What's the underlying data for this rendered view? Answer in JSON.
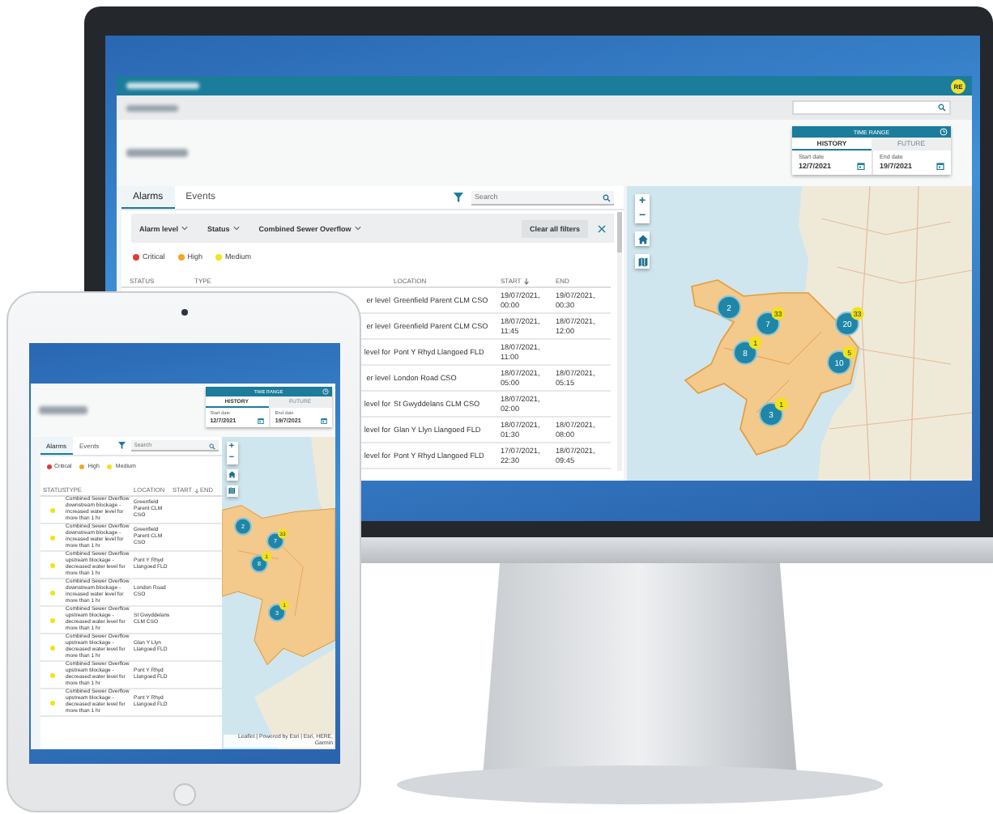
{
  "monitor": {
    "app": {
      "header": {
        "avatar": "RE"
      },
      "time_range": {
        "title": "TIME RANGE",
        "tabs": [
          {
            "label": "HISTORY",
            "selected": true
          },
          {
            "label": "FUTURE",
            "selected": false
          }
        ],
        "fields": [
          {
            "label": "Start date",
            "value": "12/7/2021"
          },
          {
            "label": "End date",
            "value": "19/7/2021"
          }
        ]
      },
      "alarms": {
        "tabs": [
          {
            "label": "Alarms",
            "selected": true
          },
          {
            "label": "Events",
            "selected": false
          }
        ],
        "search": {
          "placeholder": "Search"
        },
        "filters": [
          "Alarm level",
          "Status",
          "Combined Sewer Overflow"
        ],
        "clear_button": "Clear all filters",
        "legend": [
          {
            "label": "Critical",
            "color": "#e53935"
          },
          {
            "label": "High",
            "color": "#f5a623"
          },
          {
            "label": "Medium",
            "color": "#f2e21b"
          }
        ],
        "table": {
          "columns": [
            {
              "label": "STATUS",
              "sorted": false
            },
            {
              "label": "TYPE",
              "sorted": false
            },
            {
              "label": "LOCATION",
              "sorted": false
            },
            {
              "label": "START",
              "sorted": true
            },
            {
              "label": "END",
              "sorted": false
            }
          ],
          "rows": [
            {
              "type": "er level",
              "location": "Greenfield Parent CLM CSO",
              "start": "19/07/2021, 00:00",
              "end": "19/07/2021, 00:30"
            },
            {
              "type": "er level",
              "location": "Greenfield Parent CLM CSO",
              "start": "18/07/2021, 11:45",
              "end": "18/07/2021, 12:00"
            },
            {
              "type": "level for",
              "location": "Pont Y Rhyd Llangoed FLD",
              "start": "18/07/2021, 11:00"
            },
            {
              "type": "er level",
              "location": "London Road CSO",
              "start": "18/07/2021, 05:00",
              "end": "18/07/2021, 05:15"
            },
            {
              "type": "level for",
              "location": "St Gwyddelans CLM CSO",
              "start": "18/07/2021, 02:00"
            },
            {
              "type": "level for",
              "location": "Glan Y Llyn Llangoed FLD",
              "start": "18/07/2021, 01:30",
              "end": "18/07/2021, 08:00"
            },
            {
              "type": "level for",
              "location": "Pont Y Rhyd Llangoed FLD",
              "start": "17/07/2021, 22:30",
              "end": "18/07/2021, 09:45"
            }
          ]
        }
      },
      "map": {
        "zoom_in": "+",
        "zoom_out": "−",
        "clusters": [
          {
            "count": "2"
          },
          {
            "count": "7",
            "badge": "33"
          },
          {
            "count": "20",
            "badge": "33"
          },
          {
            "count": "8",
            "badge": "1"
          },
          {
            "count": "10",
            "badge": "5"
          },
          {
            "count": "3",
            "badge": "1"
          }
        ]
      }
    }
  },
  "tablet": {
    "app": {
      "time_range": {
        "title": "TIME RANGE",
        "tabs": [
          {
            "label": "HISTORY",
            "selected": true
          },
          {
            "label": "FUTURE",
            "selected": false
          }
        ],
        "fields": [
          {
            "label": "Start date",
            "value": "12/7/2021"
          },
          {
            "label": "End date",
            "value": "19/7/2021"
          }
        ]
      },
      "alarms": {
        "tabs": [
          {
            "label": "Alarms",
            "selected": true
          },
          {
            "label": "Events",
            "selected": false
          }
        ],
        "search": {
          "placeholder": "Search"
        },
        "legend": [
          {
            "label": "Critical",
            "color": "#e53935"
          },
          {
            "label": "High",
            "color": "#f5a623"
          },
          {
            "label": "Medium",
            "color": "#f2e21b"
          }
        ],
        "table": {
          "columns": [
            {
              "label": "STATUS",
              "sorted": false
            },
            {
              "label": "TYPE",
              "sorted": false
            },
            {
              "label": "LOCATION",
              "sorted": false
            },
            {
              "label": "START",
              "sorted": true
            },
            {
              "label": "END",
              "sorted": false
            }
          ],
          "rows": [
            {
              "color": "#f2e21b",
              "type": "Combined Sewer Overflow downstream blockage - increased water level for more than 1 hr",
              "location": "Greenfield Parent CLM CSO"
            },
            {
              "color": "#f2e21b",
              "type": "Combined Sewer Overflow downstream blockage - increased water level for more than 1 hr",
              "location": "Greenfield Parent CLM CSO"
            },
            {
              "color": "#f2e21b",
              "type": "Combined Sewer Overflow upstream blockage - decreased water level for more than 1 hr",
              "location": "Pont Y Rhyd Llangoed FLD"
            },
            {
              "color": "#f2e21b",
              "type": "Combined Sewer Overflow downstream blockage - increased water level for more than 1 hr",
              "location": "London Road CSO"
            },
            {
              "color": "#f2e21b",
              "type": "Combined Sewer Overflow upstream blockage - decreased water level for more than 1 hr",
              "location": "St Gwyddelans CLM CSO"
            },
            {
              "color": "#f2e21b",
              "type": "Combined Sewer Overflow upstream blockage - decreased water level for more than 1 hr",
              "location": "Glan Y Llyn Llangoed FLD"
            },
            {
              "color": "#f2e21b",
              "type": "Combined Sewer Overflow upstream blockage - decreased water level for more than 1 hr",
              "location": "Pont Y Rhyd Llangoed FLD"
            },
            {
              "color": "#f2e21b",
              "type": "Combined Sewer Overflow upstream blockage - decreased water level for more than 1 hr",
              "location": "Pont Y Rhyd Llangoed FLD"
            }
          ]
        }
      },
      "map": {
        "zoom_in": "+",
        "zoom_out": "−",
        "clusters": [
          {
            "count": "2"
          },
          {
            "count": "7",
            "badge": "33"
          },
          {
            "count": "8",
            "badge": "1"
          },
          {
            "count": "3",
            "badge": "1"
          }
        ],
        "attribution": "Leaflet | Powered by Esri | Esri, HERE, Garmin"
      }
    }
  }
}
